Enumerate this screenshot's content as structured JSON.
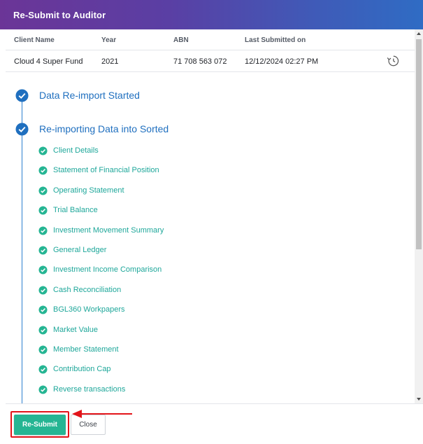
{
  "dialog": {
    "title": "Re-Submit to Auditor"
  },
  "table": {
    "headers": [
      "Client Name",
      "Year",
      "ABN",
      "Last Submitted on"
    ],
    "row": [
      "Cloud 4 Super Fund",
      "2021",
      "71 708 563 072",
      "12/12/2024 02:27 PM"
    ]
  },
  "steps": [
    {
      "label": "Data Re-import Started"
    },
    {
      "label": "Re-importing Data into Sorted"
    }
  ],
  "substeps": [
    "Client Details",
    "Statement of Financial Position",
    "Operating Statement",
    "Trial Balance",
    "Investment Movement Summary",
    "General Ledger",
    "Investment Income Comparison",
    "Cash Reconciliation",
    "BGL360 Workpapers",
    "Market Value",
    "Member Statement",
    "Contribution Cap",
    "Reverse transactions"
  ],
  "footer": {
    "resubmit_label": "Re-Submit",
    "close_label": "Close"
  },
  "colors": {
    "header_start": "#6b3597",
    "header_end": "#2f6cc4",
    "accent_blue": "#1f6fbf",
    "success_teal": "#25b593",
    "highlight_red": "#e3141a"
  },
  "icons": {
    "history": "history-icon",
    "step_done": "check-circle-icon",
    "substep_done": "check-circle-icon"
  }
}
